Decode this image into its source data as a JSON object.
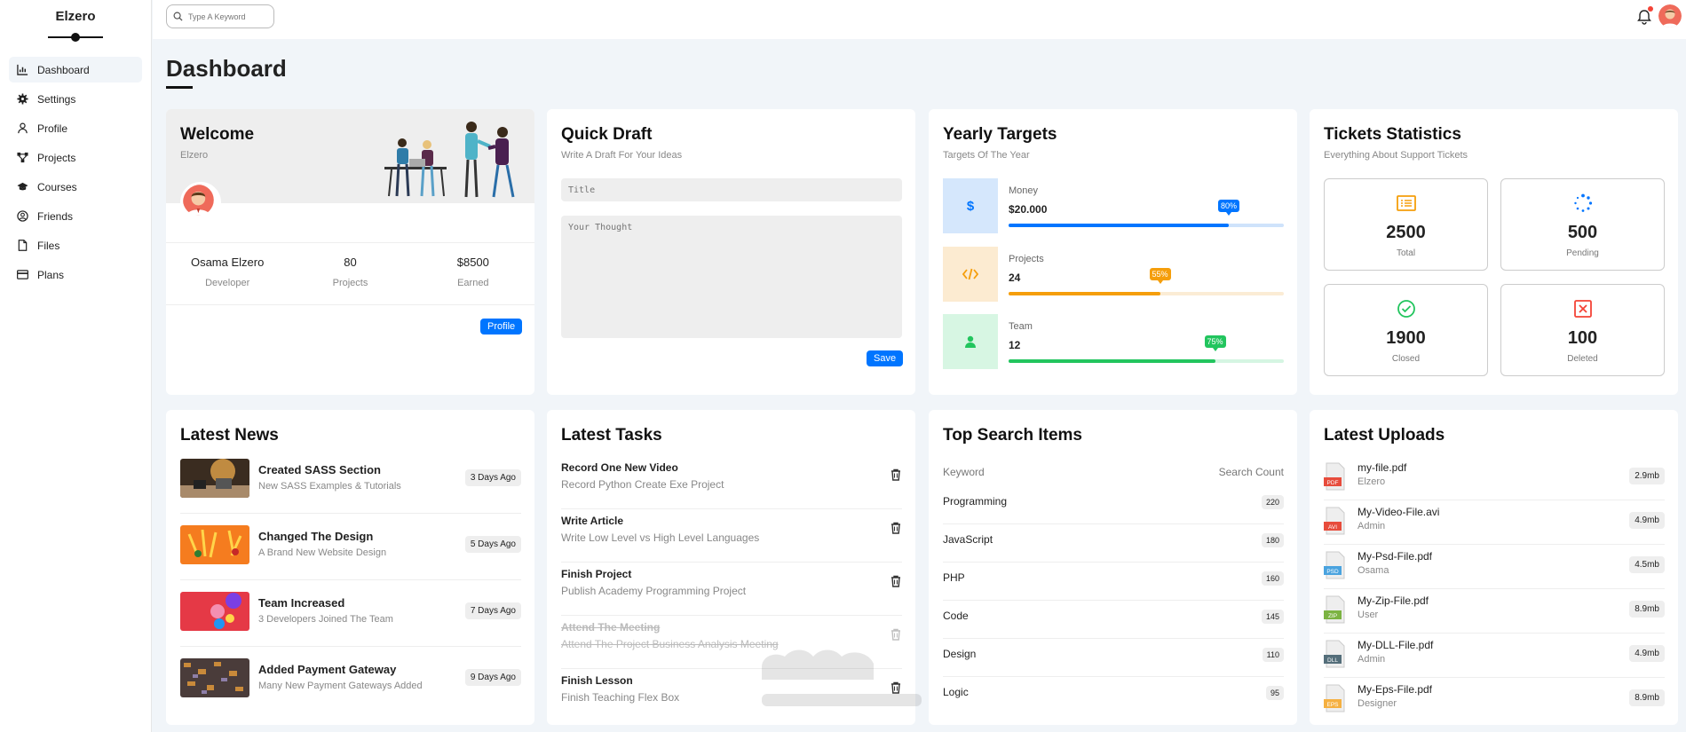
{
  "sidebar": {
    "brand": "Elzero",
    "items": [
      {
        "label": "Dashboard",
        "icon": "chart-icon",
        "active": true
      },
      {
        "label": "Settings",
        "icon": "gear-icon"
      },
      {
        "label": "Profile",
        "icon": "user-icon"
      },
      {
        "label": "Projects",
        "icon": "diagram-icon"
      },
      {
        "label": "Courses",
        "icon": "graduation-cap-icon"
      },
      {
        "label": "Friends",
        "icon": "user-circle-icon"
      },
      {
        "label": "Files",
        "icon": "file-icon"
      },
      {
        "label": "Plans",
        "icon": "credit-card-icon"
      }
    ]
  },
  "header": {
    "search_placeholder": "Type A Keyword"
  },
  "page": {
    "title": "Dashboard"
  },
  "welcome": {
    "title": "Welcome",
    "subtitle": "Elzero",
    "stats": [
      {
        "value": "Osama Elzero",
        "label": "Developer"
      },
      {
        "value": "80",
        "label": "Projects"
      },
      {
        "value": "$8500",
        "label": "Earned"
      }
    ],
    "button": "Profile"
  },
  "draft": {
    "title": "Quick Draft",
    "subtitle": "Write A Draft For Your Ideas",
    "title_placeholder": "Title",
    "body_placeholder": "Your Thought",
    "button": "Save"
  },
  "targets": {
    "title": "Yearly Targets",
    "subtitle": "Targets Of The Year",
    "items": [
      {
        "label": "Money",
        "value": "$20.000",
        "percent": 80,
        "badge": "80%",
        "color": "#0075ff",
        "light": "#d5e7fc",
        "track": "#cfe3fb",
        "icon": "dollar-icon"
      },
      {
        "label": "Projects",
        "value": "24",
        "percent": 55,
        "badge": "55%",
        "color": "#f59e0b",
        "light": "#fcebd1",
        "track": "#fbecd5",
        "icon": "code-icon"
      },
      {
        "label": "Team",
        "value": "12",
        "percent": 75,
        "badge": "75%",
        "color": "#22c55e",
        "light": "#d7f6e3",
        "track": "#d5f5e2",
        "icon": "user-icon"
      }
    ]
  },
  "tickets": {
    "title": "Tickets Statistics",
    "subtitle": "Everything About Support Tickets",
    "items": [
      {
        "value": "2500",
        "label": "Total",
        "color": "#f59e0b",
        "icon": "list-icon"
      },
      {
        "value": "500",
        "label": "Pending",
        "color": "#0075ff",
        "icon": "spinner-icon"
      },
      {
        "value": "1900",
        "label": "Closed",
        "color": "#22c55e",
        "icon": "check-circle-icon"
      },
      {
        "value": "100",
        "label": "Deleted",
        "color": "#f44336",
        "icon": "x-square-icon"
      }
    ]
  },
  "news": {
    "title": "Latest News",
    "items": [
      {
        "title": "Created SASS Section",
        "desc": "New SASS Examples & Tutorials",
        "time": "3 Days Ago"
      },
      {
        "title": "Changed The Design",
        "desc": "A Brand New Website Design",
        "time": "5 Days Ago"
      },
      {
        "title": "Team Increased",
        "desc": "3 Developers Joined The Team",
        "time": "7 Days Ago"
      },
      {
        "title": "Added Payment Gateway",
        "desc": "Many New Payment Gateways Added",
        "time": "9 Days Ago"
      }
    ]
  },
  "tasks": {
    "title": "Latest Tasks",
    "items": [
      {
        "title": "Record One New Video",
        "desc": "Record Python Create Exe Project",
        "done": false
      },
      {
        "title": "Write Article",
        "desc": "Write Low Level vs High Level Languages",
        "done": false
      },
      {
        "title": "Finish Project",
        "desc": "Publish Academy Programming Project",
        "done": false
      },
      {
        "title": "Attend The Meeting",
        "desc": "Attend The Project Business Analysis Meeting",
        "done": true
      },
      {
        "title": "Finish Lesson",
        "desc": "Finish Teaching Flex Box",
        "done": false
      }
    ]
  },
  "search_items": {
    "title": "Top Search Items",
    "col_keyword": "Keyword",
    "col_count": "Search Count",
    "items": [
      {
        "keyword": "Programming",
        "count": "220"
      },
      {
        "keyword": "JavaScript",
        "count": "180"
      },
      {
        "keyword": "PHP",
        "count": "160"
      },
      {
        "keyword": "Code",
        "count": "145"
      },
      {
        "keyword": "Design",
        "count": "110"
      },
      {
        "keyword": "Logic",
        "count": "95"
      }
    ]
  },
  "uploads": {
    "title": "Latest Uploads",
    "items": [
      {
        "name": "my-file.pdf",
        "owner": "Elzero",
        "size": "2.9mb",
        "ext": "PDF",
        "color": "#e74c3c"
      },
      {
        "name": "My-Video-File.avi",
        "owner": "Admin",
        "size": "4.9mb",
        "ext": "AVI",
        "color": "#e74c3c"
      },
      {
        "name": "My-Psd-File.pdf",
        "owner": "Osama",
        "size": "4.5mb",
        "ext": "PSD",
        "color": "#4aa3df"
      },
      {
        "name": "My-Zip-File.pdf",
        "owner": "User",
        "size": "8.9mb",
        "ext": "ZIP",
        "color": "#7cb342"
      },
      {
        "name": "My-DLL-File.pdf",
        "owner": "Admin",
        "size": "4.9mb",
        "ext": "DLL",
        "color": "#546e7a"
      },
      {
        "name": "My-Eps-File.pdf",
        "owner": "Designer",
        "size": "8.9mb",
        "ext": "EPS",
        "color": "#f5b041"
      }
    ]
  }
}
